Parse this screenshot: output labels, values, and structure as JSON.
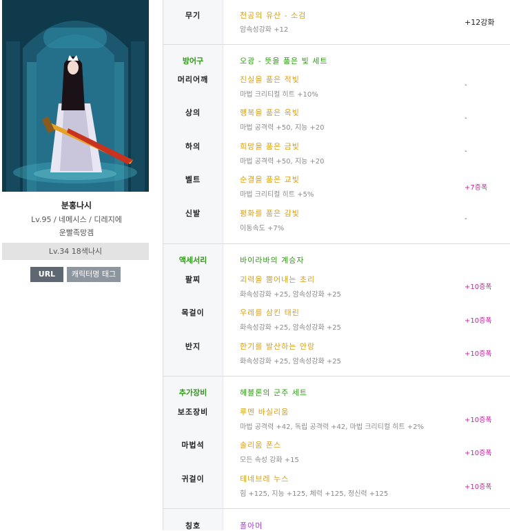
{
  "character": {
    "name": "분홍나시",
    "info": "Lv.95 / 네메시스 / 디레지에",
    "guild": "운빨족망겜",
    "adventure": "Lv.34 18색나시",
    "url_button": "URL",
    "tag_button": "캐릭터명 태그"
  },
  "weapon": {
    "slot": "무기",
    "name": "천공의 유산 - 소검",
    "stat": "암속성강화 +12",
    "reinforce": "+12강화"
  },
  "armor": {
    "category": "방어구",
    "set": "오광 - 뜻을 품은 빛 세트",
    "items": [
      {
        "slot": "머리어깨",
        "name": "진실을 품은 적빛",
        "stat": "마법 크리티컬 히트 +10%",
        "reinforce": "-"
      },
      {
        "slot": "상의",
        "name": "행복을 품은 옥빛",
        "stat": "마법 공격력 +50, 지능 +20",
        "reinforce": "-"
      },
      {
        "slot": "하의",
        "name": "희망을 품은 금빛",
        "stat": "마법 공격력 +50, 지능 +20",
        "reinforce": "-"
      },
      {
        "slot": "벨트",
        "name": "순결을 품은 교빛",
        "stat": "마법 크리티컬 히트 +5%",
        "reinforce": "+7증폭"
      },
      {
        "slot": "신발",
        "name": "평화를 품은 감빛",
        "stat": "이동속도 +7%",
        "reinforce": "-"
      }
    ]
  },
  "accessory": {
    "category": "액세서리",
    "set": "바이라바의 계승자",
    "items": [
      {
        "slot": "팔찌",
        "name": "괴력을 뿜어내는 초리",
        "stat": "화속성강화 +25, 암속성강화 +25",
        "reinforce": "+10증폭"
      },
      {
        "slot": "목걸이",
        "name": "우레를 삼킨 태린",
        "stat": "화속성강화 +25, 암속성강화 +25",
        "reinforce": "+10증폭"
      },
      {
        "slot": "반지",
        "name": "한기를 발산하는 안랑",
        "stat": "화속성강화 +25, 암속성강화 +25",
        "reinforce": "+10증폭"
      }
    ]
  },
  "extra": {
    "category": "추가장비",
    "set": "헤블론의 군주 세트",
    "items": [
      {
        "slot": "보조장비",
        "name": "루멘 바실리움",
        "stat": "마법 공격력 +42, 독립 공격력 +42, 마법 크리티컬 히트 +2%",
        "reinforce": "+10증폭"
      },
      {
        "slot": "마법석",
        "name": "솔리움 폰스",
        "stat": "모든 속성 강화 +15",
        "reinforce": "+10증폭"
      },
      {
        "slot": "귀걸이",
        "name": "테네브레 누스",
        "stat": "힘 +125, 지능 +125, 체력 +125, 정신력 +125",
        "reinforce": "+10증폭"
      }
    ]
  },
  "title": {
    "slot": "칭호",
    "name": "폴아머"
  },
  "colors": {
    "category_green": "#2f9a15",
    "item_gold": "#d8a01a",
    "item_purple": "#a33fce",
    "reinforce_pink": "#c7249a"
  }
}
